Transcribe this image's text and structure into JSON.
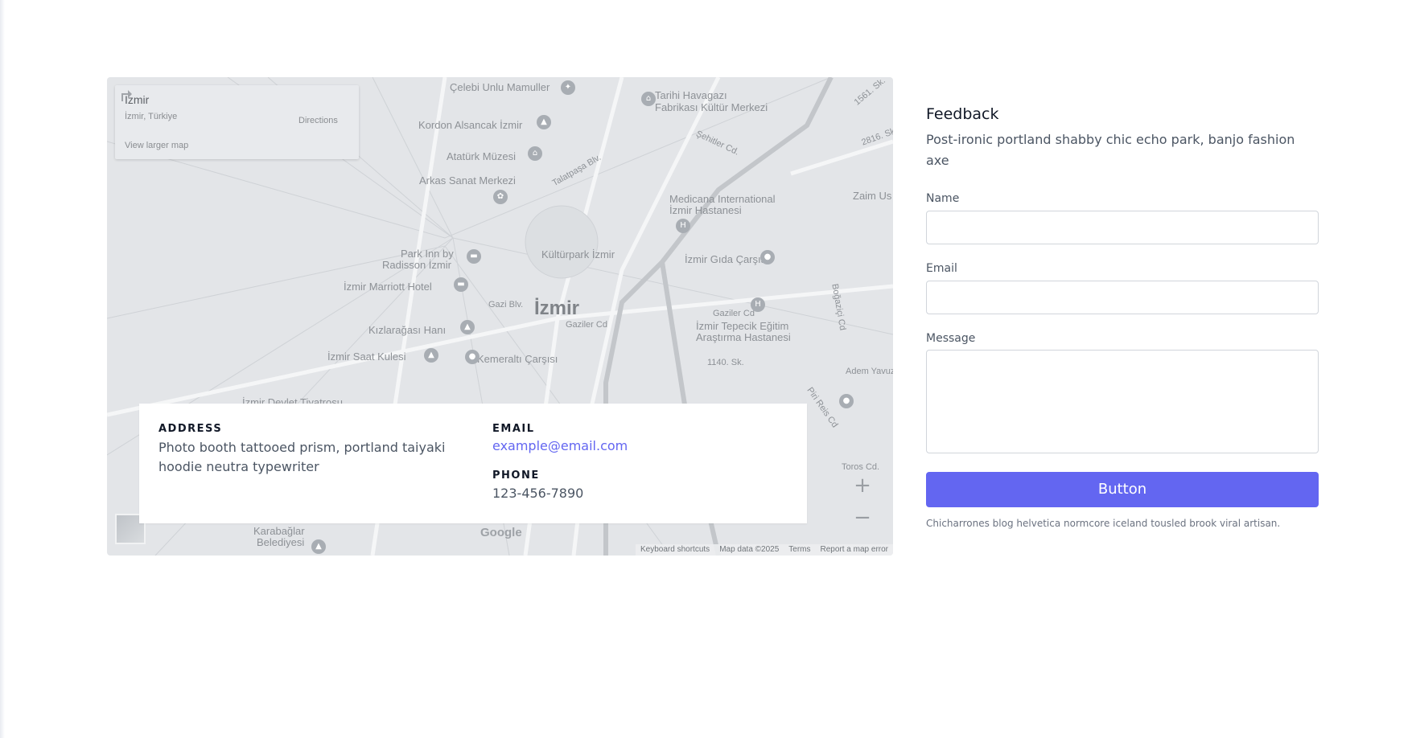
{
  "map": {
    "place_name": "İzmir",
    "place_region": "İzmir, Türkiye",
    "view_larger": "View larger map",
    "directions": "Directions",
    "city_label": "İzmir",
    "labels": {
      "l1": "Çelebi Unlu Mamuller",
      "l2": "Tarihi Havagazı",
      "l3": "Fabrikası Kültür Merkezi",
      "l4": "Kordon Alsancak İzmir",
      "l5": "Atatürk Müzesi",
      "l6": "Arkas Sanat Merkezi",
      "l7": "Medicana International",
      "l8": "İzmir Hastanesi",
      "l9": "Kültürpark İzmir",
      "l10": "Park Inn by",
      "l11": "Radisson İzmir",
      "l12": "İzmir Gıda Çarşısı",
      "l13": "İzmir Marriott Hotel",
      "l14": "Kızlarağası Hanı",
      "l15": "İzmir Tepecik Eğitim",
      "l16": "Araştırma Hastanesi",
      "l17": "İzmir Saat Kulesi",
      "l18": "Kemeraltı Çarşısı",
      "l19": "Karabağlar",
      "l20": "Belediyesi",
      "l21": "Gazi Blv.",
      "l22": "Gaziler Cd",
      "l23": "Talatpaşa Blv.",
      "l24": "Şehitler Cd.",
      "l25": "1140. Sk.",
      "l26": "Zaim Us",
      "l27": "Adem Yavuz",
      "l28": "Toros Cd.",
      "l29": "Piri Reis Cd",
      "l30": "Boğaziçi Cd",
      "l31": "1561. Sk.",
      "l32": "2816. Sk.",
      "l33": "İzmir Devlet Tiyatrosu"
    },
    "google": "Google",
    "attribution": [
      "Keyboard shortcuts",
      "Map data ©2025",
      "Terms",
      "Report a map error"
    ]
  },
  "info": {
    "address_heading": "ADDRESS",
    "address_text": "Photo booth tattooed prism, portland taiyaki hoodie neutra typewriter",
    "email_heading": "EMAIL",
    "email_value": "example@email.com",
    "phone_heading": "PHONE",
    "phone_value": "123-456-7890"
  },
  "feedback": {
    "title": "Feedback",
    "description": "Post-ironic portland shabby chic echo park, banjo fashion axe",
    "name_label": "Name",
    "email_label": "Email",
    "message_label": "Message",
    "button_label": "Button",
    "note": "Chicharrones blog helvetica normcore iceland tousled brook viral artisan."
  },
  "colors": {
    "accent": "#6366f1",
    "map_bg": "#e3e5e8"
  }
}
